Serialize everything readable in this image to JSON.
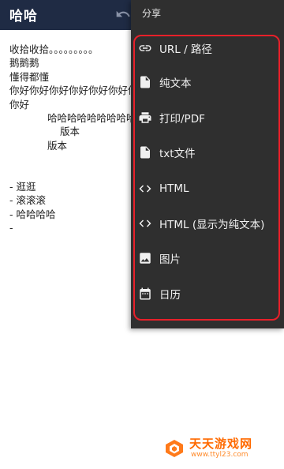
{
  "app": {
    "title": "哈哈"
  },
  "note": {
    "lines": [
      "收拾收拾。。。。。。。。。",
      "鹅鹅鹅",
      "懂得都懂",
      "你好你好你好你好你好你好你好",
      "你好",
      "哈哈哈哈哈哈哈哈哈哈",
      "版本",
      "版本",
      "",
      "",
      "- 逛逛",
      "- 滚滚滚",
      "- 哈哈哈哈",
      "-"
    ]
  },
  "share_menu": {
    "title": "分享",
    "items": [
      {
        "label": "URL / 路径",
        "icon": "link-icon"
      },
      {
        "label": "纯文本",
        "icon": "document-icon"
      },
      {
        "label": "打印/PDF",
        "icon": "printer-icon"
      },
      {
        "label": "txt文件",
        "icon": "document-icon"
      },
      {
        "label": "HTML",
        "icon": "code-icon"
      },
      {
        "label": "HTML (显示为纯文本)",
        "icon": "code-icon"
      },
      {
        "label": "图片",
        "icon": "image-icon"
      },
      {
        "label": "日历",
        "icon": "calendar-icon"
      }
    ],
    "highlight_color": "#e8202a",
    "background_color": "#2f2f2f"
  },
  "watermark": {
    "title": "天天游戏网",
    "url": "www.ttyl23.com"
  }
}
